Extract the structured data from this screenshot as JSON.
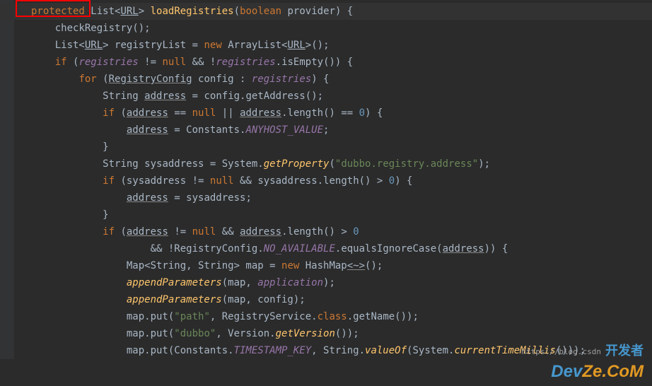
{
  "highlight_box": "protected",
  "lines": [
    {
      "indent": 1,
      "tokens": [
        {
          "t": "protected ",
          "c": "kw"
        },
        {
          "t": "List<"
        },
        {
          "t": "URL",
          "c": "underlink"
        },
        {
          "t": "> "
        },
        {
          "t": "loadRegistries",
          "c": "method"
        },
        {
          "t": "("
        },
        {
          "t": "boolean ",
          "c": "kw"
        },
        {
          "t": "provider"
        },
        {
          "t": ") {"
        }
      ]
    },
    {
      "indent": 2,
      "tokens": [
        {
          "t": "checkRegistry();"
        }
      ]
    },
    {
      "indent": 2,
      "tokens": [
        {
          "t": "List<"
        },
        {
          "t": "URL",
          "c": "underlink"
        },
        {
          "t": "> registryList = "
        },
        {
          "t": "new ",
          "c": "kw"
        },
        {
          "t": "ArrayList<"
        },
        {
          "t": "URL",
          "c": "underlink"
        },
        {
          "t": ">();"
        }
      ]
    },
    {
      "indent": 2,
      "tokens": [
        {
          "t": "if ",
          "c": "kw"
        },
        {
          "t": "("
        },
        {
          "t": "registries",
          "c": "field"
        },
        {
          "t": " != "
        },
        {
          "t": "null ",
          "c": "kw"
        },
        {
          "t": "&& !"
        },
        {
          "t": "registries",
          "c": "field"
        },
        {
          "t": ".isEmpty()) {"
        }
      ]
    },
    {
      "indent": 3,
      "tokens": [
        {
          "t": "for ",
          "c": "kw"
        },
        {
          "t": "("
        },
        {
          "t": "RegistryConfig",
          "c": "under"
        },
        {
          "t": " config : "
        },
        {
          "t": "registries",
          "c": "field"
        },
        {
          "t": ") {"
        }
      ]
    },
    {
      "indent": 4,
      "tokens": [
        {
          "t": "String "
        },
        {
          "t": "address",
          "c": "under"
        },
        {
          "t": " = config.getAddress();"
        }
      ]
    },
    {
      "indent": 4,
      "tokens": [
        {
          "t": "if ",
          "c": "kw"
        },
        {
          "t": "("
        },
        {
          "t": "address",
          "c": "under"
        },
        {
          "t": " == "
        },
        {
          "t": "null ",
          "c": "kw"
        },
        {
          "t": "|| "
        },
        {
          "t": "address",
          "c": "under"
        },
        {
          "t": ".length() == "
        },
        {
          "t": "0",
          "c": "num"
        },
        {
          "t": ") {"
        }
      ]
    },
    {
      "indent": 5,
      "tokens": [
        {
          "t": "address",
          "c": "under"
        },
        {
          "t": " = Constants."
        },
        {
          "t": "ANYHOST_VALUE",
          "c": "staticf"
        },
        {
          "t": ";"
        }
      ]
    },
    {
      "indent": 4,
      "tokens": [
        {
          "t": "}"
        }
      ]
    },
    {
      "indent": 4,
      "tokens": [
        {
          "t": "String sysaddress = System."
        },
        {
          "t": "getProperty",
          "c": "static"
        },
        {
          "t": "("
        },
        {
          "t": "\"dubbo.registry.address\"",
          "c": "str"
        },
        {
          "t": ");"
        }
      ]
    },
    {
      "indent": 4,
      "tokens": [
        {
          "t": "if ",
          "c": "kw"
        },
        {
          "t": "(sysaddress != "
        },
        {
          "t": "null ",
          "c": "kw"
        },
        {
          "t": "&& sysaddress.length() > "
        },
        {
          "t": "0",
          "c": "num"
        },
        {
          "t": ") {"
        }
      ]
    },
    {
      "indent": 5,
      "tokens": [
        {
          "t": "address",
          "c": "under"
        },
        {
          "t": " = sysaddress;"
        }
      ]
    },
    {
      "indent": 4,
      "tokens": [
        {
          "t": "}"
        }
      ]
    },
    {
      "indent": 4,
      "tokens": [
        {
          "t": "if ",
          "c": "kw"
        },
        {
          "t": "("
        },
        {
          "t": "address",
          "c": "under"
        },
        {
          "t": " != "
        },
        {
          "t": "null ",
          "c": "kw"
        },
        {
          "t": "&& "
        },
        {
          "t": "address",
          "c": "under"
        },
        {
          "t": ".length() > "
        },
        {
          "t": "0",
          "c": "num"
        }
      ]
    },
    {
      "indent": 6,
      "tokens": [
        {
          "t": "&& !RegistryConfig."
        },
        {
          "t": "NO_AVAILABLE",
          "c": "staticf"
        },
        {
          "t": ".equalsIgnoreCase("
        },
        {
          "t": "address",
          "c": "under"
        },
        {
          "t": ")) {"
        }
      ]
    },
    {
      "indent": 5,
      "tokens": [
        {
          "t": "Map<String, String> map = "
        },
        {
          "t": "new ",
          "c": "kw"
        },
        {
          "t": "HashMap"
        },
        {
          "t": "<~>",
          "c": "under"
        },
        {
          "t": "();"
        }
      ]
    },
    {
      "indent": 5,
      "tokens": [
        {
          "t": "appendParameters",
          "c": "static"
        },
        {
          "t": "(map, "
        },
        {
          "t": "application",
          "c": "field"
        },
        {
          "t": ");"
        }
      ]
    },
    {
      "indent": 5,
      "tokens": [
        {
          "t": "appendParameters",
          "c": "static"
        },
        {
          "t": "(map, config);"
        }
      ]
    },
    {
      "indent": 5,
      "tokens": [
        {
          "t": "map.put("
        },
        {
          "t": "\"path\"",
          "c": "str"
        },
        {
          "t": ", RegistryService."
        },
        {
          "t": "class",
          "c": "kw"
        },
        {
          "t": ".getName());"
        }
      ]
    },
    {
      "indent": 5,
      "tokens": [
        {
          "t": "map.put("
        },
        {
          "t": "\"dubbo\"",
          "c": "str"
        },
        {
          "t": ", Version."
        },
        {
          "t": "getVersion",
          "c": "static"
        },
        {
          "t": "());"
        }
      ]
    },
    {
      "indent": 5,
      "tokens": [
        {
          "t": "map.put(Constants."
        },
        {
          "t": "TIMESTAMP_KEY",
          "c": "staticf"
        },
        {
          "t": ", String."
        },
        {
          "t": "valueOf",
          "c": "static"
        },
        {
          "t": "(System."
        },
        {
          "t": "currentTimeMillis",
          "c": "static"
        },
        {
          "t": "()));"
        }
      ]
    }
  ],
  "watermark": {
    "cn": "开发者",
    "brand_part1": "Dev",
    "brand_part2": "Ze.CoM",
    "url": "https://blog.csdn"
  },
  "colors": {
    "background": "#2b2b2b",
    "gutter": "#313335",
    "keyword": "#cc7832",
    "string": "#6a8759",
    "number": "#6897bb",
    "method": "#ffc66d",
    "field": "#9876aa",
    "highlight_border": "#ff0000"
  }
}
